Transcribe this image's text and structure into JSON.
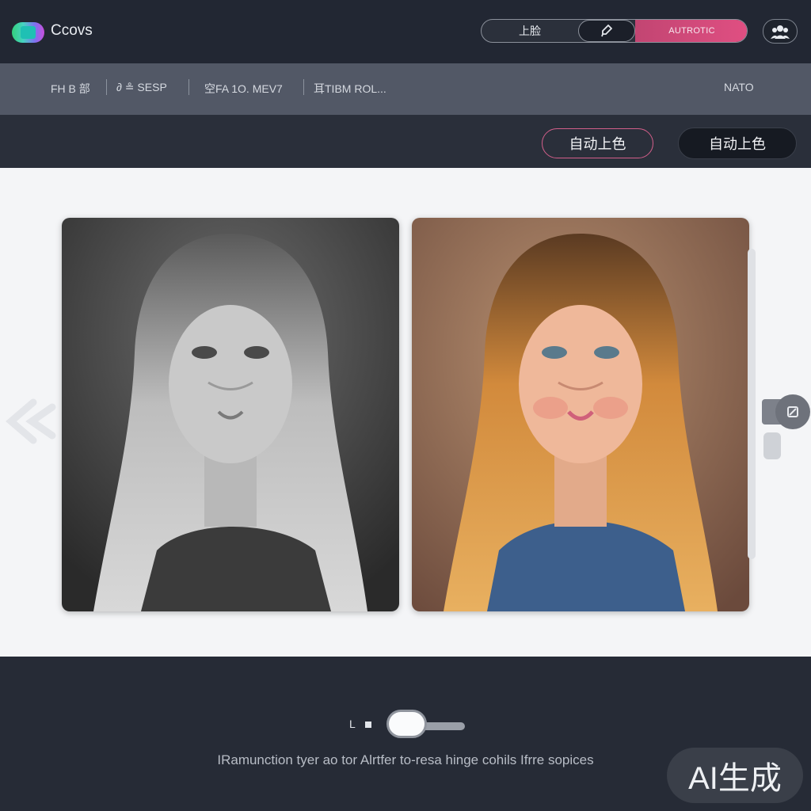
{
  "app": {
    "name": "Ccovs"
  },
  "header": {
    "segments": [
      "上脸",
      "",
      "AUTROTIC"
    ],
    "avatar_icon": "users-icon"
  },
  "nav": {
    "items": [
      "FH B 部",
      "∂ ≗ SESP",
      "空FA 1O. MEV7",
      "耳TIBM ROL..."
    ],
    "right": "NATO"
  },
  "toolbar": {
    "outline_button": "自动上色",
    "dark_button": "自动上色"
  },
  "workspace": {
    "original_image": "black-and-white portrait",
    "colorized_image": "colorized portrait",
    "left_control_icon": "back-arrow-icon",
    "right_control_icon": "compare-handle-icon"
  },
  "footer": {
    "toggle_label": "L",
    "caption": "IRamunction tyer ao tor Alrtfer to-resa hinge cohils Ifrre sopices",
    "badge": "AI生成"
  },
  "colors": {
    "accent": "#d9507f",
    "header_bg": "#222733",
    "nav_bg": "#525866",
    "workspace_bg": "#f4f5f7"
  }
}
